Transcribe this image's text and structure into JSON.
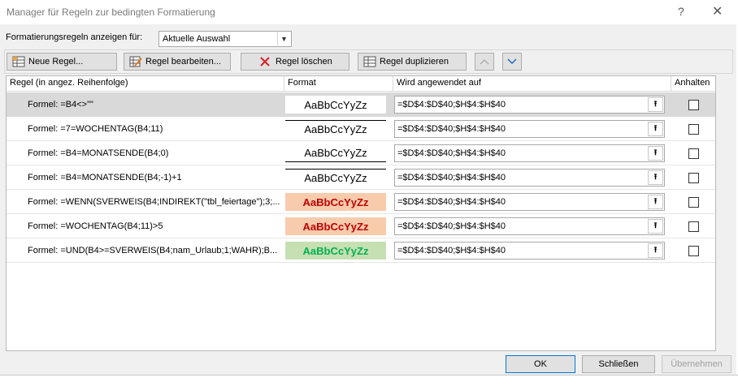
{
  "window": {
    "title": "Manager für Regeln zur bedingten Formatierung",
    "help_glyph": "?",
    "close_glyph": "✕"
  },
  "show_rules": {
    "label": "Formatierungsregeln anzeigen für:",
    "value": "Aktuelle Auswahl"
  },
  "toolbar": {
    "new_rule": "Neue Regel...",
    "edit_rule": "Regel bearbeiten...",
    "delete_rule": "Regel löschen",
    "duplicate_rule": "Regel duplizieren",
    "move_up_icon": "chevron-up-icon",
    "move_down_icon": "chevron-down-icon"
  },
  "columns": {
    "rule": "Regel (in angez. Reihenfolge)",
    "format": "Format",
    "applies_to": "Wird angewendet auf",
    "stop_if_true": "Anhalten"
  },
  "rules": [
    {
      "rule": "Formel: =B4<>\"\"",
      "preview": "AaBbCcYyZz",
      "applies_to": "=$D$4:$D$40;$H$4:$H$40",
      "selected": true,
      "style": {
        "bg": "#ffffff",
        "color": "#000000",
        "bold": false,
        "border_bottom": false,
        "border_top": false
      }
    },
    {
      "rule": "Formel: =7=WOCHENTAG(B4;11)",
      "preview": "AaBbCcYyZz",
      "applies_to": "=$D$4:$D$40;$H$4:$H$40",
      "selected": false,
      "style": {
        "bg": "#ffffff",
        "color": "#000000",
        "bold": false,
        "border_bottom": false,
        "border_top": true
      }
    },
    {
      "rule": "Formel: =B4=MONATSENDE(B4;0)",
      "preview": "AaBbCcYyZz",
      "applies_to": "=$D$4:$D$40;$H$4:$H$40",
      "selected": false,
      "style": {
        "bg": "#ffffff",
        "color": "#000000",
        "bold": false,
        "border_bottom": true,
        "border_top": false
      }
    },
    {
      "rule": "Formel: =B4=MONATSENDE(B4;-1)+1",
      "preview": "AaBbCcYyZz",
      "applies_to": "=$D$4:$D$40;$H$4:$H$40",
      "selected": false,
      "style": {
        "bg": "#ffffff",
        "color": "#000000",
        "bold": false,
        "border_bottom": false,
        "border_top": true
      }
    },
    {
      "rule": "Formel: =WENN(SVERWEIS(B4;INDIREKT(\"tbl_feiertage\");3;...",
      "preview": "AaBbCcYyZz",
      "applies_to": "=$D$4:$D$40;$H$4:$H$40",
      "selected": false,
      "style": {
        "bg": "#f8cbad",
        "color": "#c00000",
        "bold": true,
        "border_bottom": false,
        "border_top": false
      }
    },
    {
      "rule": "Formel: =WOCHENTAG(B4;11)>5",
      "preview": "AaBbCcYyZz",
      "applies_to": "=$D$4:$D$40;$H$4:$H$40",
      "selected": false,
      "style": {
        "bg": "#f8cbad",
        "color": "#c00000",
        "bold": true,
        "border_bottom": false,
        "border_top": false
      }
    },
    {
      "rule": "Formel: =UND(B4>=SVERWEIS(B4;nam_Urlaub;1;WAHR);B...",
      "preview": "AaBbCcYyZz",
      "applies_to": "=$D$4:$D$40;$H$4:$H$40",
      "selected": false,
      "style": {
        "bg": "#c6e0b4",
        "color": "#00b050",
        "bold": true,
        "border_bottom": false,
        "border_top": false
      }
    }
  ],
  "footer": {
    "ok": "OK",
    "close": "Schließen",
    "apply": "Übernehmen"
  }
}
